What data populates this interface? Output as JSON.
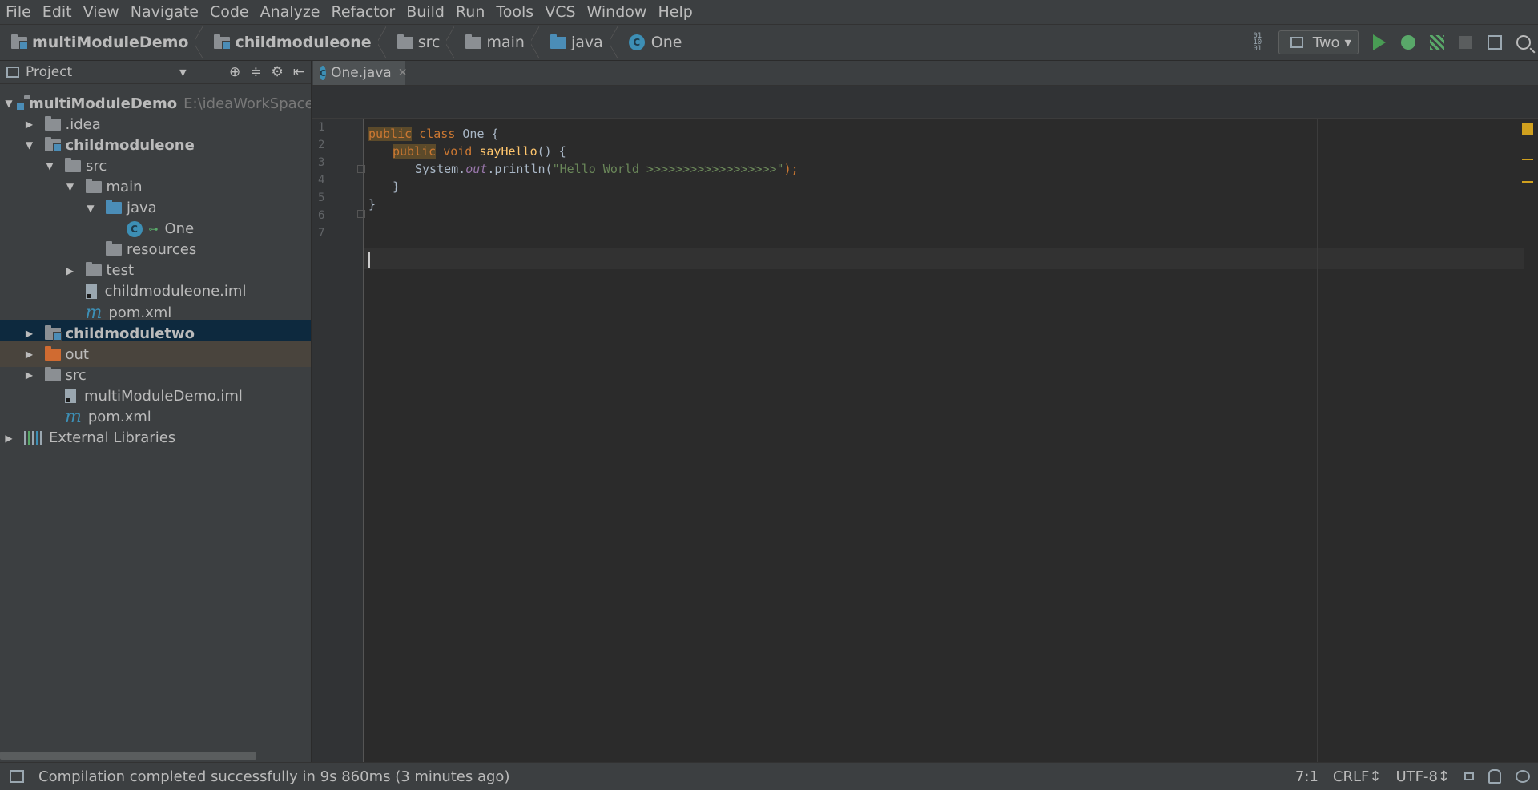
{
  "menu": [
    "File",
    "Edit",
    "View",
    "Navigate",
    "Code",
    "Analyze",
    "Refactor",
    "Build",
    "Run",
    "Tools",
    "VCS",
    "Window",
    "Help"
  ],
  "breadcrumbs": [
    {
      "label": "multiModuleDemo",
      "icon": "module-folder-icon",
      "bold": true
    },
    {
      "label": "childmoduleone",
      "icon": "module-folder-icon",
      "bold": true
    },
    {
      "label": "src",
      "icon": "folder-icon",
      "bold": false
    },
    {
      "label": "main",
      "icon": "folder-icon",
      "bold": false
    },
    {
      "label": "java",
      "icon": "source-folder-icon",
      "bold": false
    },
    {
      "label": "One",
      "icon": "class-icon",
      "bold": false
    }
  ],
  "toolbar": {
    "run_config": "Two",
    "run_config_icon": "run-config-icon",
    "class_icon_letter": "C"
  },
  "project": {
    "title": "Project",
    "tree": [
      {
        "label": "multiModuleDemo",
        "path": "E:\\ideaWorkSpace\\multiMo",
        "depth": 0,
        "arrow": "open",
        "icon": "module",
        "bold": true
      },
      {
        "label": ".idea",
        "depth": 1,
        "arrow": "closed",
        "icon": "folder"
      },
      {
        "label": "childmoduleone",
        "depth": 1,
        "arrow": "open",
        "icon": "module",
        "bold": true
      },
      {
        "label": "src",
        "depth": 2,
        "arrow": "open",
        "icon": "folder"
      },
      {
        "label": "main",
        "depth": 3,
        "arrow": "open",
        "icon": "folder"
      },
      {
        "label": "java",
        "depth": 4,
        "arrow": "open",
        "icon": "source"
      },
      {
        "label": "One",
        "depth": 5,
        "arrow": "none",
        "icon": "class"
      },
      {
        "label": "resources",
        "depth": 4,
        "arrow": "none",
        "icon": "folder"
      },
      {
        "label": "test",
        "depth": 3,
        "arrow": "closed",
        "icon": "folder"
      },
      {
        "label": "childmoduleone.iml",
        "depth": 3,
        "arrow": "none",
        "icon": "file"
      },
      {
        "label": "pom.xml",
        "depth": 3,
        "arrow": "none",
        "icon": "maven"
      },
      {
        "label": "childmoduletwo",
        "depth": 1,
        "arrow": "closed",
        "icon": "module",
        "bold": true,
        "state": "selected"
      },
      {
        "label": "out",
        "depth": 1,
        "arrow": "closed",
        "icon": "excluded",
        "state": "excluded"
      },
      {
        "label": "src",
        "depth": 1,
        "arrow": "closed",
        "icon": "folder"
      },
      {
        "label": "multiModuleDemo.iml",
        "depth": 2,
        "arrow": "none",
        "icon": "file"
      },
      {
        "label": "pom.xml",
        "depth": 2,
        "arrow": "none",
        "icon": "maven"
      },
      {
        "label": "External Libraries",
        "depth": 0,
        "arrow": "closed",
        "icon": "library"
      }
    ]
  },
  "editor": {
    "tab_label": "One.java",
    "line_numbers": [
      "1",
      "2",
      "3",
      "4",
      "5",
      "6",
      "7"
    ],
    "code": {
      "l2_kw1": "public",
      "l2_kw2": "class",
      "l2_rest": " One {",
      "l3_kw1": "public",
      "l3_kw2": "void",
      "l3_fn": "sayHello",
      "l3_rest": "() {",
      "l4_pre": "System.",
      "l4_field": "out",
      "l4_mid": ".println(",
      "l4_str": "\"Hello World >>>>>>>>>>>>>>>>>>\"",
      "l4_end": ");",
      "l5": "}",
      "l6": "}"
    }
  },
  "status": {
    "message": "Compilation completed successfully in 9s 860ms (3 minutes ago)",
    "position": "7:1",
    "line_sep": "CRLF↕",
    "encoding": "UTF-8↕"
  },
  "colors": {
    "background": "#2b2b2b",
    "panel": "#3c3f41",
    "selected_row": "#0d293e",
    "excluded_row": "#49443d",
    "keyword": "#cc7832",
    "string": "#6a8759",
    "method": "#ffc66d",
    "run_green": "#499c54"
  }
}
